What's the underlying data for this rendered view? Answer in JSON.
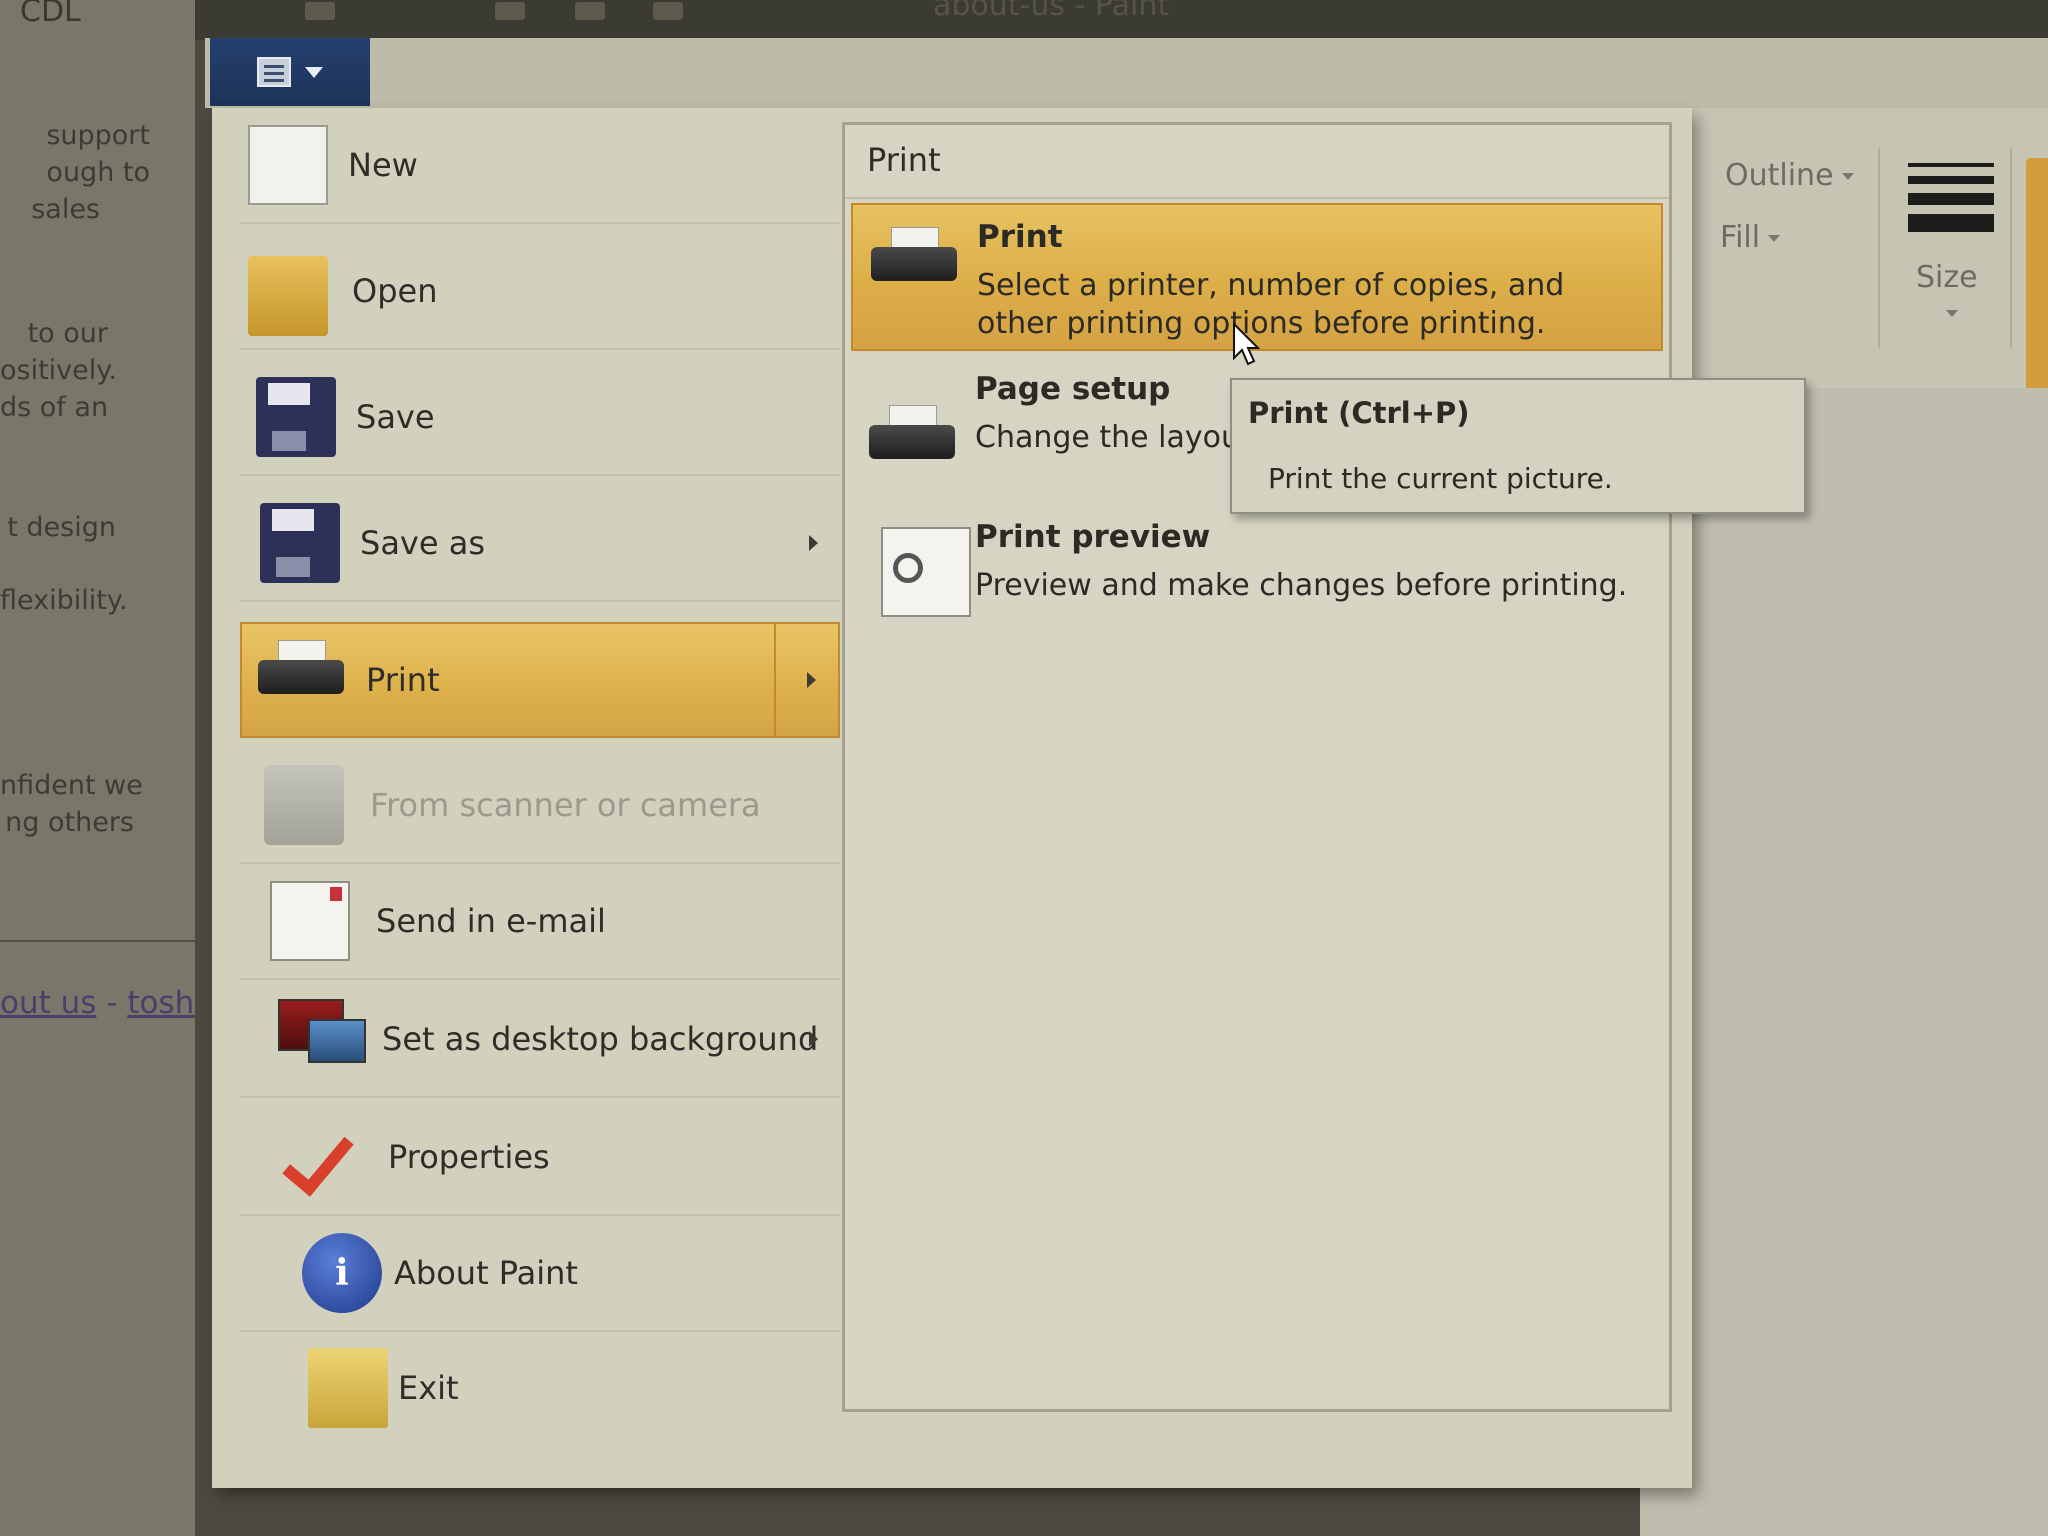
{
  "window": {
    "title": "about-us - Paint"
  },
  "background_doc": {
    "title_fragment": "CDL",
    "lines": [
      "support",
      "ough to",
      "sales",
      "to our",
      "ositively.",
      "ds of an",
      "t design",
      "flexibility.",
      "nfident we",
      "ng others"
    ],
    "link_1": "out us",
    "link_sep": " - ",
    "link_2": "toshib"
  },
  "ribbon": {
    "outline_label": "Outline",
    "fill_label": "Fill",
    "size_label": "Size"
  },
  "app_menu": {
    "items": [
      {
        "label": "New",
        "icon": "new-document-icon",
        "submenu": false,
        "disabled": false
      },
      {
        "label": "Open",
        "icon": "open-folder-icon",
        "submenu": false,
        "disabled": false
      },
      {
        "label": "Save",
        "icon": "floppy-disk-icon",
        "submenu": false,
        "disabled": false
      },
      {
        "label": "Save as",
        "icon": "save-as-icon",
        "submenu": true,
        "disabled": false
      },
      {
        "label": "Print",
        "icon": "printer-icon",
        "submenu": true,
        "disabled": false,
        "active": true
      },
      {
        "label": "From scanner or camera",
        "icon": "scanner-icon",
        "submenu": false,
        "disabled": true
      },
      {
        "label": "Send in e-mail",
        "icon": "email-icon",
        "submenu": false,
        "disabled": false
      },
      {
        "label": "Set as desktop background",
        "icon": "desktop-background-icon",
        "submenu": true,
        "disabled": false
      },
      {
        "label": "Properties",
        "icon": "checkmark-icon",
        "submenu": false,
        "disabled": false
      },
      {
        "label": "About Paint",
        "icon": "info-icon",
        "submenu": false,
        "disabled": false
      },
      {
        "label": "Exit",
        "icon": "exit-icon",
        "submenu": false,
        "disabled": false
      }
    ]
  },
  "print_submenu": {
    "heading": "Print",
    "items": [
      {
        "title": "Print",
        "description": "Select a printer, number of copies, and other printing options before printing.",
        "icon": "printer-icon",
        "active": true
      },
      {
        "title": "Page setup",
        "description": "Change the layout",
        "icon": "page-setup-icon"
      },
      {
        "title": "Print preview",
        "description": "Preview and make changes before printing.",
        "icon": "print-preview-icon"
      }
    ]
  },
  "tooltip": {
    "title": "Print (Ctrl+P)",
    "description": "Print the current picture."
  },
  "colors": {
    "highlight": "#ddb04a",
    "highlight_border": "#c2892f",
    "file_tab": "#1d3359",
    "menu_bg": "#d2d1be"
  }
}
